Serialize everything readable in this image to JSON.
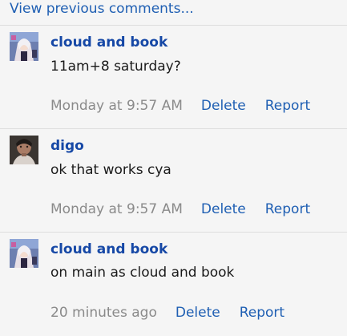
{
  "view_previous_label": "View previous comments...",
  "colors": {
    "link": "#1f5fb3",
    "author": "#1648a6",
    "muted": "#8a8a8a",
    "background": "#f5f5f5"
  },
  "comments": [
    {
      "author": "cloud and book",
      "text": "11am+8 saturday?",
      "timestamp": "Monday at 9:57 AM",
      "delete_label": "Delete",
      "report_label": "Report",
      "avatar": "anime-avatar-icon"
    },
    {
      "author": "digo",
      "text": "ok that works cya",
      "timestamp": "Monday at 9:57 AM",
      "delete_label": "Delete",
      "report_label": "Report",
      "avatar": "photo-avatar-icon"
    },
    {
      "author": "cloud and book",
      "text": "on main as cloud and book",
      "timestamp": "20 minutes ago",
      "delete_label": "Delete",
      "report_label": "Report",
      "avatar": "anime-avatar-icon"
    }
  ]
}
